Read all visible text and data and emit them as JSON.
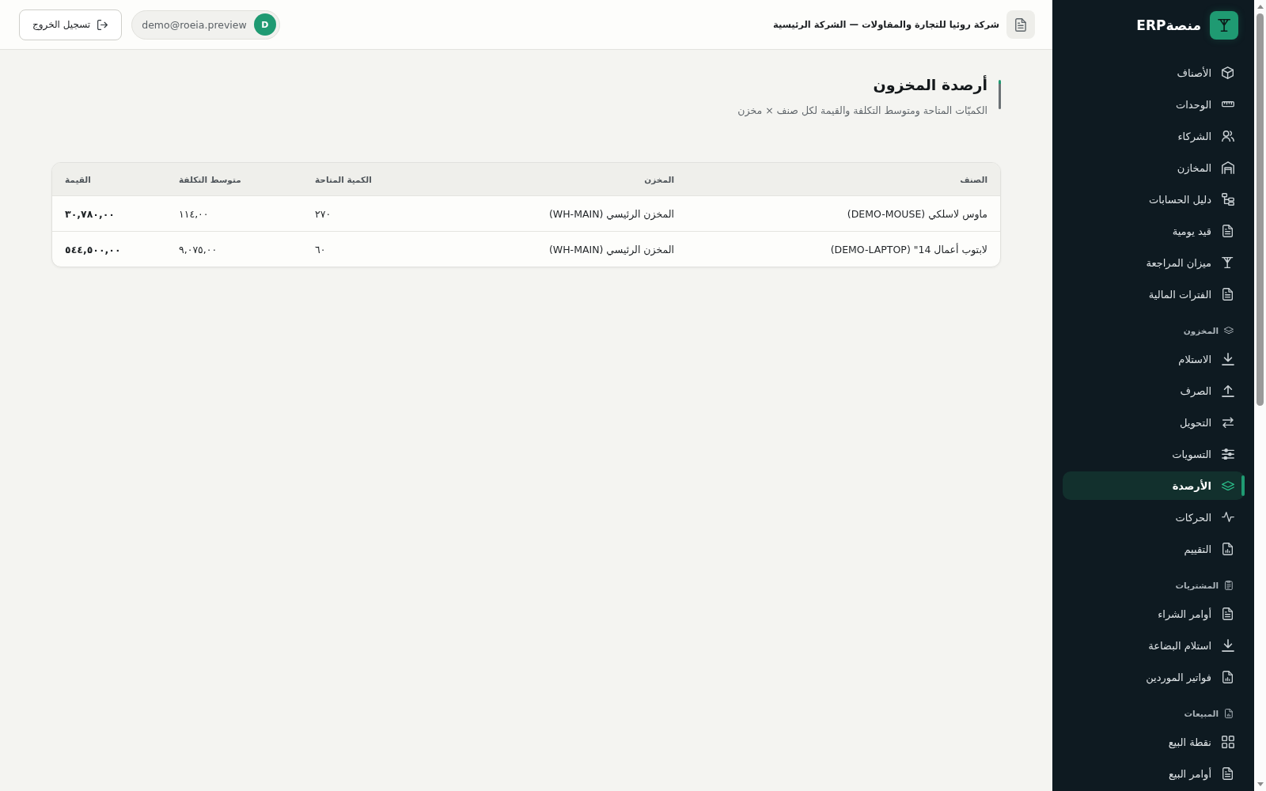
{
  "header": {
    "company": "شركة روئيا للتجارة والمقاولات — الشركة الرئيسية",
    "user": {
      "initial": "D",
      "email": "demo@roeia.preview"
    },
    "logout_button": "تسجيل الخروج"
  },
  "page": {
    "title": "أرصدة المخزون",
    "subtitle": "الكميّات المتاحة ومتوسط التكلفة والقيمة لكل صنف × مخزن"
  },
  "table": {
    "columns": [
      {
        "label": "الصنف",
        "kind": "text"
      },
      {
        "label": "المخزن",
        "kind": "text"
      },
      {
        "label": "الكمية المتاحة",
        "kind": "number"
      },
      {
        "label": "متوسط التكلفة",
        "kind": "number"
      },
      {
        "label": "القيمة",
        "kind": "total"
      }
    ],
    "rows": [
      {
        "cells": [
          "ماوس لاسلكي (DEMO-MOUSE)",
          "المخزن الرئيسي (WH-MAIN)",
          "٢٧٠",
          "١١٤,٠٠",
          "٣٠,٧٨٠,٠٠"
        ]
      },
      {
        "cells": [
          "لابتوب أعمال 14\" (DEMO-LAPTOP)",
          "المخزن الرئيسي (WH-MAIN)",
          "٦٠",
          "٩,٠٧٥,٠٠",
          "٥٤٤,٥٠٠,٠٠"
        ]
      }
    ]
  },
  "sidebar": {
    "brand": "منصةERP",
    "groups": [
      {
        "items": [
          {
            "label": "الأصناف",
            "selected": false
          },
          {
            "label": "الوحدات",
            "selected": false
          },
          {
            "label": "الشركاء",
            "selected": false
          },
          {
            "label": "المخازن",
            "selected": false
          },
          {
            "label": "دليل الحسابات",
            "selected": false
          },
          {
            "label": "قيد يومية",
            "selected": false
          },
          {
            "label": "ميزان المراجعة",
            "selected": false
          },
          {
            "label": "الفترات المالية",
            "selected": false
          }
        ]
      },
      {
        "title": "المخزون",
        "items": [
          {
            "label": "الاستلام",
            "selected": false
          },
          {
            "label": "الصرف",
            "selected": false
          },
          {
            "label": "التحويل",
            "selected": false
          },
          {
            "label": "التسويات",
            "selected": false
          },
          {
            "label": "الأرصدة",
            "selected": true
          },
          {
            "label": "الحركات",
            "selected": false
          },
          {
            "label": "التقييم",
            "selected": false
          }
        ]
      },
      {
        "title": "المشتريات",
        "items": [
          {
            "label": "أوامر الشراء",
            "selected": false
          },
          {
            "label": "استلام البضاعة",
            "selected": false
          },
          {
            "label": "فواتير الموردين",
            "selected": false
          }
        ]
      },
      {
        "title": "المبيعات",
        "items": [
          {
            "label": "نقطة البيع",
            "selected": false
          },
          {
            "label": "أوامر البيع",
            "selected": false
          }
        ]
      }
    ]
  }
}
